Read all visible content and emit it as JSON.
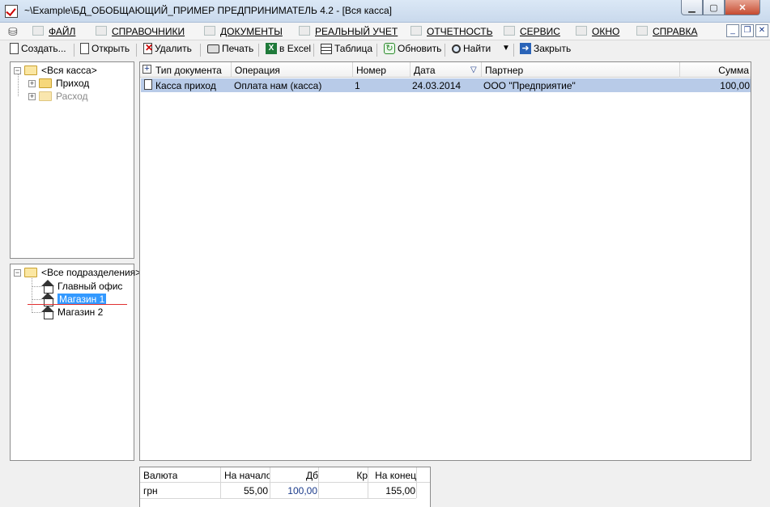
{
  "window": {
    "title": "~\\Example\\БД_ОБОБЩАЮЩИЙ_ПРИМЕР  ПРЕДПРИНИМАТЕЛЬ 4.2 - [Вся касса]"
  },
  "menu": {
    "items": [
      {
        "label": "ФАЙЛ",
        "icon": "file-icon"
      },
      {
        "label": "СПРАВОЧНИКИ",
        "icon": "home-icon"
      },
      {
        "label": "ДОКУМЕНТЫ",
        "icon": "document-icon"
      },
      {
        "label": "РЕАЛЬНЫЙ УЧЕТ",
        "icon": "grid-icon"
      },
      {
        "label": "ОТЧЕТНОСТЬ",
        "icon": "report-icon"
      },
      {
        "label": "СЕРВИС",
        "icon": "service-icon"
      },
      {
        "label": "ОКНО",
        "icon": "window-icon"
      },
      {
        "label": "СПРАВКА",
        "icon": "help-icon"
      }
    ]
  },
  "toolbar": {
    "create": "Создать...",
    "open": "Открыть",
    "delete": "Удалить",
    "print": "Печать",
    "excel": "в Excel",
    "excel_icon_text": "X",
    "table": "Таблица",
    "refresh": "Обновить",
    "find": "Найти",
    "close": "Закрыть"
  },
  "tree_cash": {
    "root": "<Вся касса>",
    "children": [
      {
        "label": "Приход",
        "enabled": true
      },
      {
        "label": "Расход",
        "enabled": false
      }
    ]
  },
  "tree_departments": {
    "root": "<Все подразделения>",
    "children": [
      {
        "label": "Главный офис"
      },
      {
        "label": "Магазин 1",
        "selected": true
      },
      {
        "label": "Магазин 2"
      }
    ]
  },
  "grid": {
    "columns": [
      "Тип документа",
      "Операция",
      "Номер",
      "Дата",
      "Партнер",
      "Сумма"
    ],
    "rows": [
      {
        "type": "Касса приход",
        "operation": "Оплата нам (касса)",
        "number": "1",
        "date": "24.03.2014",
        "partner": "ООО \"Предприятие\"",
        "sum": "100,00"
      }
    ]
  },
  "summary": {
    "columns": [
      "Валюта",
      "На начало",
      "Дб",
      "Кр",
      "На конец"
    ],
    "rows": [
      {
        "currency": "грн",
        "start": "55,00",
        "debit": "100,00",
        "credit": "",
        "end": "155,00"
      }
    ]
  },
  "colors": {
    "selection": "#b8cbe8",
    "tree_selected": "#3399ff",
    "annotation_line": "#e03030"
  }
}
